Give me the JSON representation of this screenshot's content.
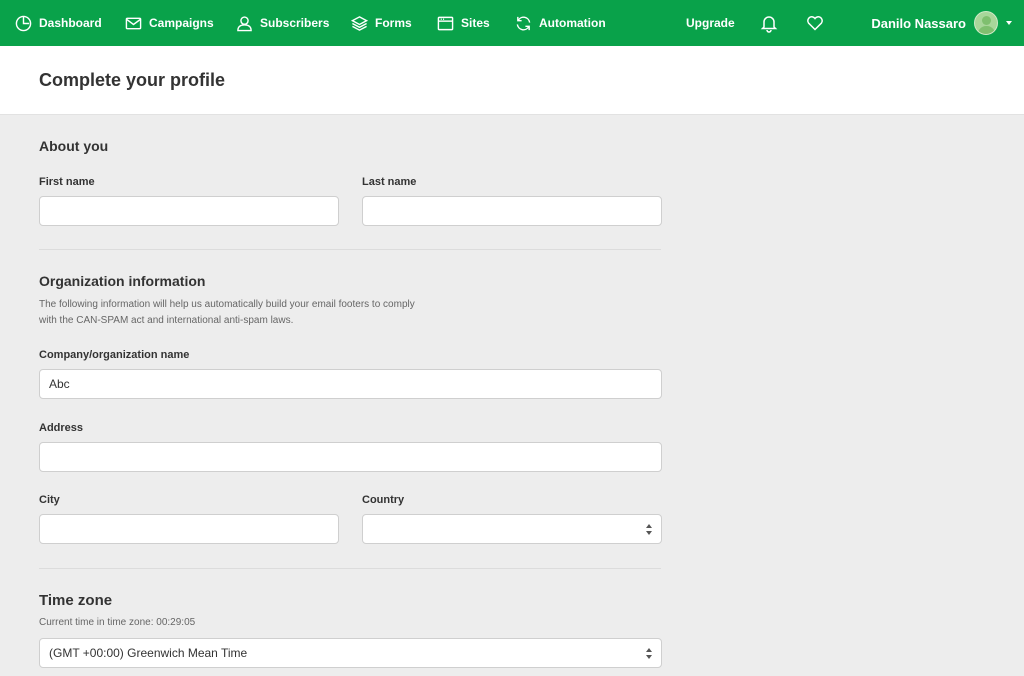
{
  "nav": {
    "items": [
      {
        "label": "Dashboard",
        "icon": "clock-icon"
      },
      {
        "label": "Campaigns",
        "icon": "envelope-icon"
      },
      {
        "label": "Subscribers",
        "icon": "person-icon"
      },
      {
        "label": "Forms",
        "icon": "layers-icon"
      },
      {
        "label": "Sites",
        "icon": "browser-window-icon"
      },
      {
        "label": "Automation",
        "icon": "refresh-icon"
      }
    ],
    "upgrade_label": "Upgrade",
    "user_name": "Danilo Nassaro",
    "brand_color": "#09a24a"
  },
  "page": {
    "title": "Complete your profile"
  },
  "about": {
    "title": "About you",
    "first_name_label": "First name",
    "first_name_value": "",
    "last_name_label": "Last name",
    "last_name_value": ""
  },
  "org": {
    "title": "Organization information",
    "description_line1": "The following information will help us automatically build your email footers to comply",
    "description_line2": "with the CAN-SPAM act and international anti-spam laws.",
    "company_label": "Company/organization name",
    "company_value": "Abc",
    "address_label": "Address",
    "address_value": "",
    "city_label": "City",
    "city_value": "",
    "country_label": "Country",
    "country_value": ""
  },
  "timezone": {
    "title": "Time zone",
    "current_time": "Current time in time zone: 00:29:05",
    "selected": "(GMT +00:00) Greenwich Mean Time"
  }
}
